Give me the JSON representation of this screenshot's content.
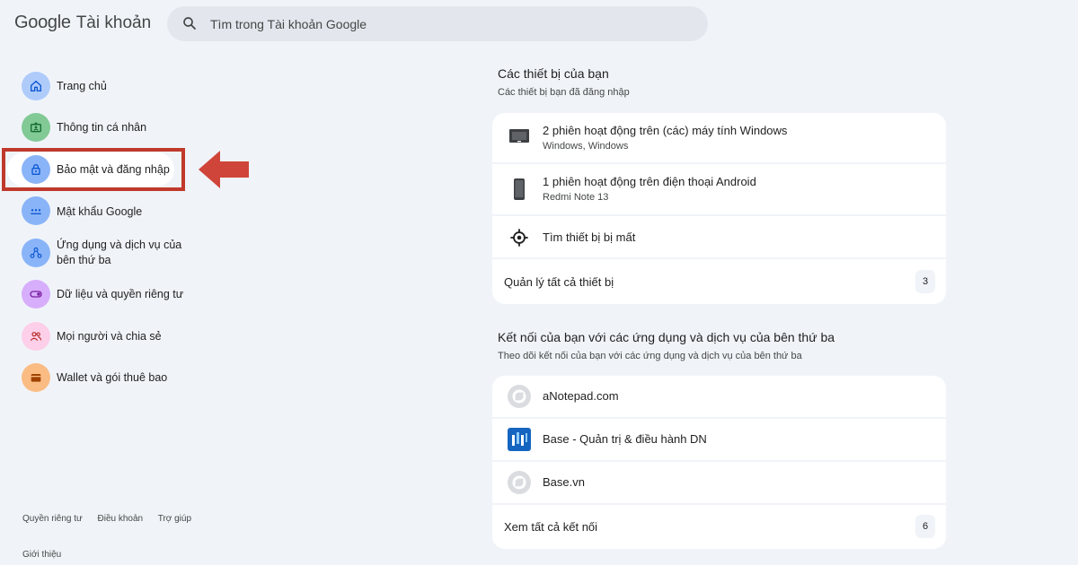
{
  "header": {
    "logo_google": "Google",
    "logo_product": "Tài khoản",
    "search_placeholder": "Tìm trong Tài khoản Google"
  },
  "sidebar": {
    "items": [
      {
        "label": "Trang chủ",
        "icon": "home-icon",
        "color": "#aecbfa"
      },
      {
        "label": "Thông tin cá nhân",
        "icon": "id-card-icon",
        "color": "#81c995"
      },
      {
        "label": "Bảo mật và đăng nhập",
        "icon": "lock-icon",
        "color": "#8ab4f8"
      },
      {
        "label": "Mật khẩu Google",
        "icon": "password-dots-icon",
        "color": "#8ab4f8"
      },
      {
        "label_line1": "Ứng dụng và dịch vụ của",
        "label_line2": "bên thứ ba",
        "icon": "connected-apps-icon",
        "color": "#8ab4f8"
      },
      {
        "label": "Dữ liệu và quyền riêng tư",
        "icon": "toggle-icon",
        "color": "#d7aefb"
      },
      {
        "label": "Mọi người và chia sẻ",
        "icon": "people-icon",
        "color": "#fdcfe8"
      },
      {
        "label": "Wallet và gói thuê bao",
        "icon": "wallet-icon",
        "color": "#fbbc84"
      }
    ],
    "selected_index": 2
  },
  "footer": {
    "privacy": "Quyền riêng tư",
    "terms": "Điều khoản",
    "help": "Trợ giúp",
    "about": "Giới thiệu"
  },
  "devices": {
    "title": "Các thiết bị của bạn",
    "subtitle": "Các thiết bị bạn đã đăng nhập",
    "rows": [
      {
        "title": "2 phiên hoạt động trên (các) máy tính Windows",
        "sub": "Windows, Windows",
        "icon": "laptop-icon"
      },
      {
        "title": "1 phiên hoạt động trên điện thoại Android",
        "sub": "Redmi Note 13",
        "icon": "phone-icon"
      },
      {
        "title": "Tìm thiết bị bị mất",
        "icon": "locate-icon"
      }
    ],
    "manage_label": "Quản lý tất cả thiết bị",
    "manage_count": "3"
  },
  "connections": {
    "title": "Kết nối của bạn với các ứng dụng và dịch vụ của bên thứ ba",
    "subtitle": "Theo dõi kết nối của bạn với các ứng dụng và dịch vụ của bên thứ ba",
    "rows": [
      {
        "title": "aNotepad.com",
        "icon": "generic-app-icon"
      },
      {
        "title": "Base - Quản trị & điều hành DN",
        "icon": "base-logo-icon",
        "color": "#1565c0"
      },
      {
        "title": "Base.vn",
        "icon": "generic-app-icon"
      }
    ],
    "view_all_label": "Xem tất cả kết nối",
    "view_all_count": "6"
  },
  "colors": {
    "background": "#f0f4f9",
    "highlight": "#c0392b",
    "card": "#ffffff"
  }
}
